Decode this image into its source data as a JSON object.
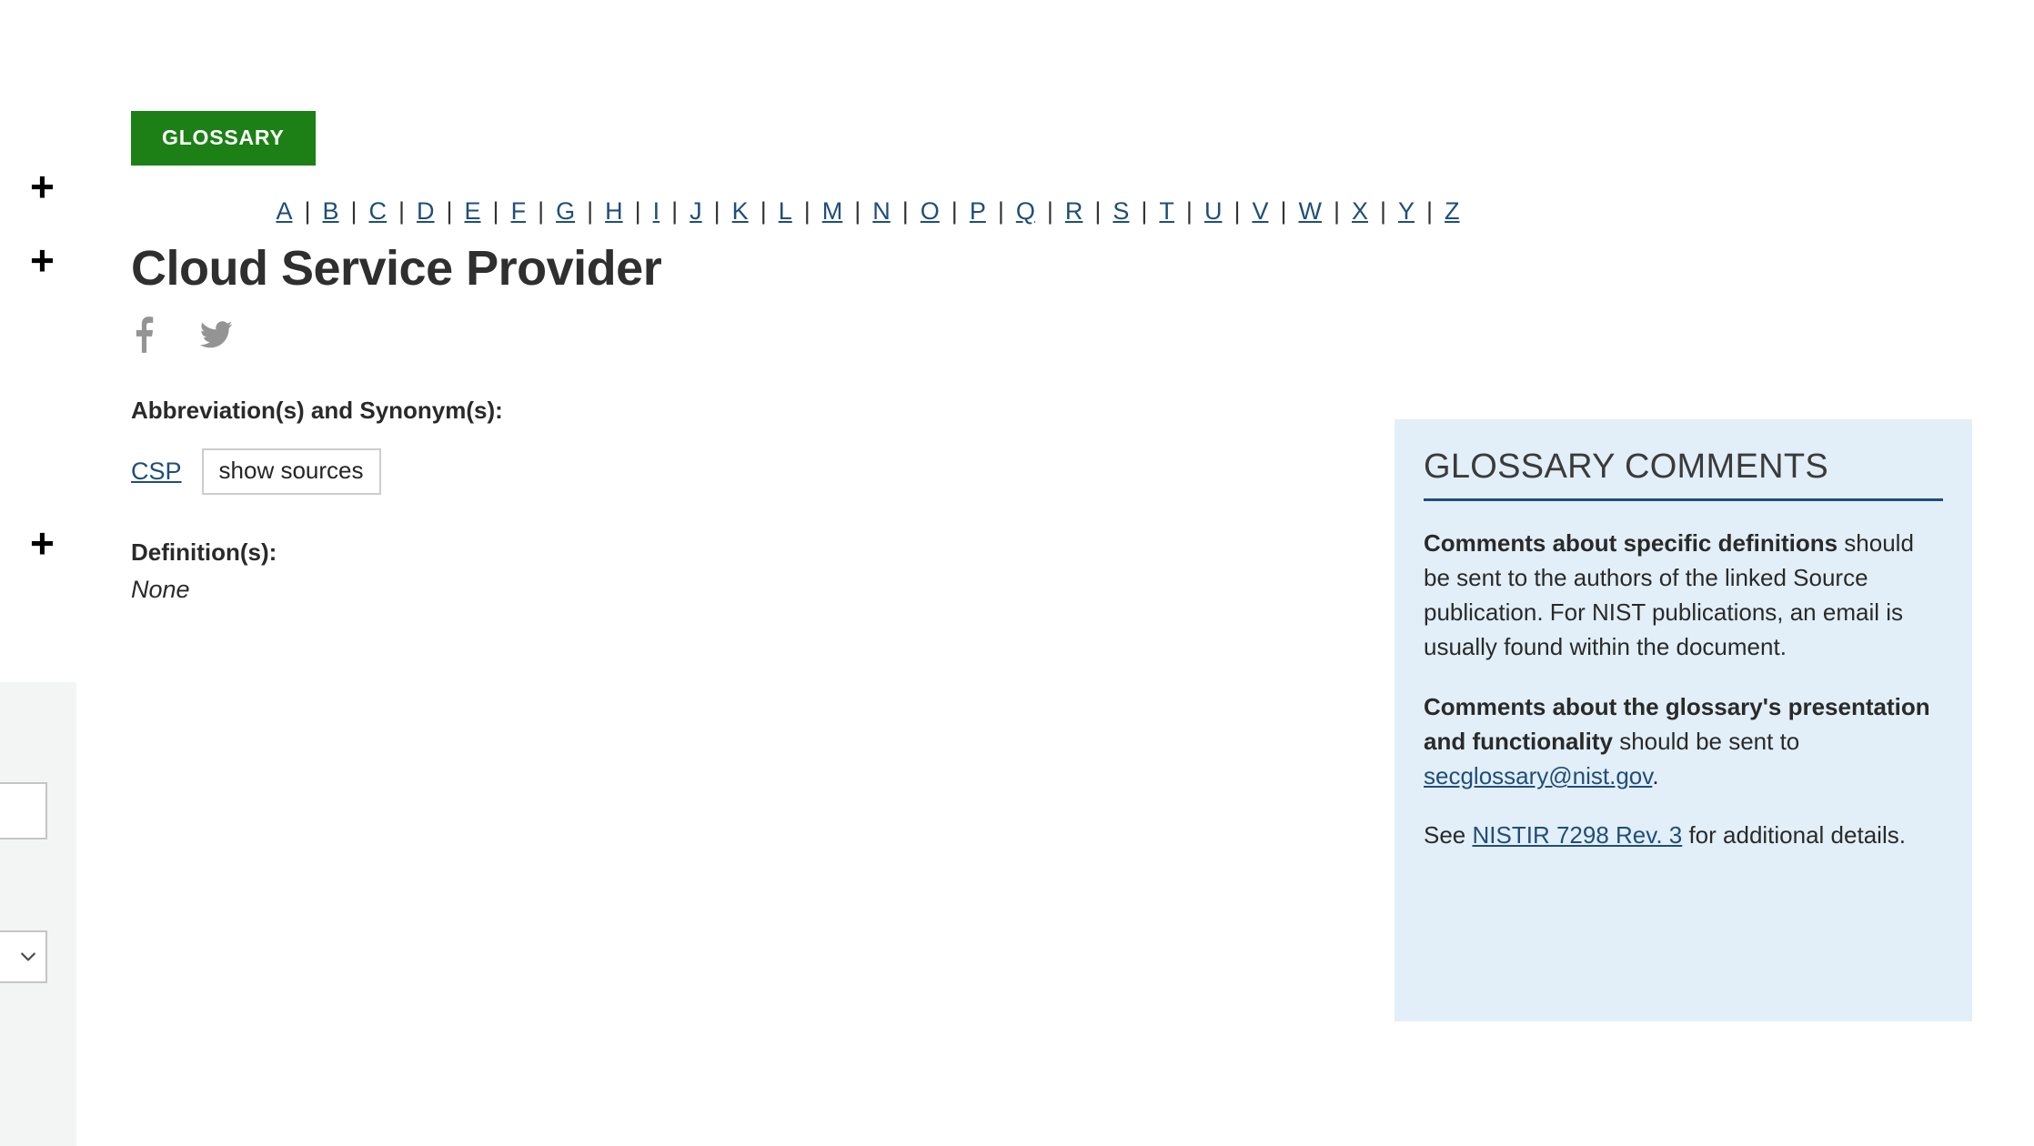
{
  "badge": {
    "label": "GLOSSARY"
  },
  "az_nav": {
    "letters": [
      "A",
      "B",
      "C",
      "D",
      "E",
      "F",
      "G",
      "H",
      "I",
      "J",
      "K",
      "L",
      "M",
      "N",
      "O",
      "P",
      "Q",
      "R",
      "S",
      "T",
      "U",
      "V",
      "W",
      "X",
      "Y",
      "Z"
    ],
    "separator": "|"
  },
  "term": {
    "title": "Cloud Service Provider",
    "abbreviation_label": "Abbreviation(s) and Synonym(s):",
    "abbreviation": "CSP",
    "show_sources_label": "show sources",
    "definition_label": "Definition(s):",
    "definition_value": "None"
  },
  "social": {
    "facebook": "facebook-icon",
    "twitter": "twitter-icon"
  },
  "comments": {
    "heading": "GLOSSARY COMMENTS",
    "p1_bold": "Comments about specific definitions",
    "p1_rest": " should be sent to the authors of the linked Source publication. For NIST publications, an email is usually found within the document.",
    "p2_bold": "Comments about the glossary's presentation and functionality",
    "p2_mid": " should be sent to ",
    "p2_link": "secglossary@nist.gov",
    "p2_end": ".",
    "p3_start": "See ",
    "p3_link": "NISTIR 7298 Rev. 3",
    "p3_end": " for additional details."
  },
  "left_markers": {
    "plus": "+"
  },
  "filter_panel": {
    "input_value": "",
    "select_value": ""
  },
  "colors": {
    "badge_green": "#1C8017",
    "link_blue": "#1F4E79",
    "sidebar_blue": "#E2EFF8",
    "panel_gray": "#F3F4F4"
  }
}
